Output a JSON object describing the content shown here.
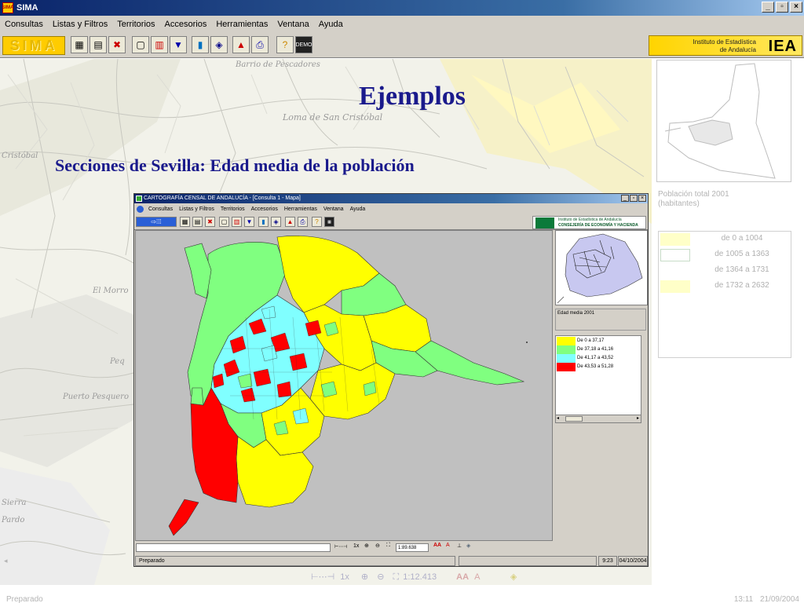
{
  "window": {
    "title": "SIMA",
    "menu": [
      "Consultas",
      "Listas y Filtros",
      "Territorios",
      "Accesorios",
      "Herramientas",
      "Ventana",
      "Ayuda"
    ],
    "logo_left": "SIMA",
    "logo_right_line1": "Instituto de Estadística",
    "logo_right_line2": "de Andalucía",
    "logo_right_abbr": "IEA",
    "controls": [
      "_",
      "▫",
      "×"
    ]
  },
  "slide": {
    "title": "Ejemplos",
    "subtitle": "Secciones de Sevilla: Edad media de la población"
  },
  "background_map": {
    "labels": [
      "Barrio de Pescadores",
      "Loma de San Cristóbal",
      "Puerto Pesquero",
      "Peq",
      "Cristóbal",
      "El Morro",
      "Pardo",
      "Sierra"
    ]
  },
  "outer_panel": {
    "legend_title_line1": "Población total 2001",
    "legend_title_line2": "(habitantes)",
    "legend": [
      {
        "label": "de 0 a 1004",
        "color": "#ffffc8"
      },
      {
        "label": "de 1005 a 1363",
        "color": "#ffffff"
      },
      {
        "label": "de 1364 a 1731",
        "color": "#ffffff"
      },
      {
        "label": "de 1732 a 2632",
        "color": "#ffffc8"
      }
    ]
  },
  "inner_window": {
    "title": "CARTOGRAFÍA CENSAL DE ANDALUCÍA - [Consulta 1 - Mapa]",
    "menu": [
      "Consultas",
      "Listas y Filtros",
      "Territorios",
      "Accesorios",
      "Herramientas",
      "Ventana",
      "Ayuda"
    ],
    "logo_line1": "Instituto de Estadística de Andalucía",
    "logo_line2": "CONSEJERÍA DE ECONOMÍA Y HACIENDA",
    "legend_title": "Edad media 2001",
    "legend": [
      {
        "label": "De 0 a 37,17",
        "color": "#ffff00"
      },
      {
        "label": "De 37,18 a 41,16",
        "color": "#80ff80"
      },
      {
        "label": "De 41,17 a 43,52",
        "color": "#80ffff"
      },
      {
        "label": "De 43,53 a 51,28",
        "color": "#ff0000"
      }
    ],
    "zoom_label": "1x",
    "scale_value": "1:89.638",
    "status": "Preparado",
    "time": "9:23",
    "date": "04/10/2004"
  },
  "outer_bottom": {
    "zoom_label": "1x",
    "scale_value": "1:12.413",
    "status": "Preparado",
    "time": "13:11",
    "date": "21/09/2004"
  },
  "colors": {
    "title_blue": "#1a1a8c",
    "class_yellow": "#ffff00",
    "class_green": "#80ff80",
    "class_cyan": "#80ffff",
    "class_red": "#ff0000",
    "map_bg": "#c0c0c0"
  }
}
